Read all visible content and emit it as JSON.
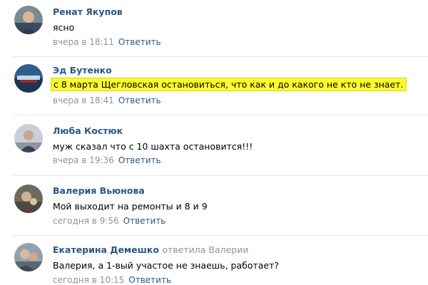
{
  "comments": [
    {
      "author": "Ренат Якупов",
      "reply_to": "",
      "text": "ясно",
      "time": "вчера в 18:11",
      "reply_label": "Ответить",
      "highlight": false
    },
    {
      "author": "Эд Бутенко",
      "reply_to": "",
      "text": "с 8 марта Щегловская остановиться, что как и до какого не кто не знает.",
      "time": "вчера в 18:41",
      "reply_label": "Ответить",
      "highlight": true,
      "highlight_color": "#fbfb2a"
    },
    {
      "author": "Люба Костюк",
      "reply_to": "",
      "text": "муж сказал что с 10 шахта остановится!!!",
      "time": "вчера в 19:36",
      "reply_label": "Ответить",
      "highlight": false
    },
    {
      "author": "Валерия Вьюнова",
      "reply_to": "",
      "text": "Мой выходит на ремонты и 8 и 9",
      "time": "сегодня в 9:56",
      "reply_label": "Ответить",
      "highlight": false
    },
    {
      "author": "Екатерина Демешко",
      "reply_to": "ответила Валерии",
      "text": "Валерия, а 1-вый участое не знаешь, работает?",
      "time": "сегодня в 10:15",
      "reply_label": "Ответить",
      "highlight": false
    }
  ],
  "colors": {
    "link": "#2a5885",
    "meta": "#939393",
    "separator": "#e3e6ea"
  }
}
